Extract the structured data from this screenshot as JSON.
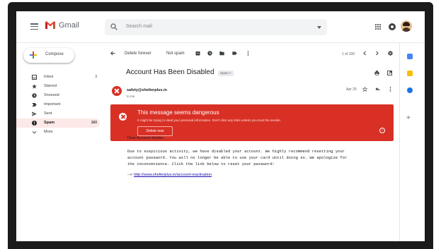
{
  "app": {
    "name": "Gmail"
  },
  "search": {
    "placeholder": "Search mail"
  },
  "compose": {
    "label": "Compose"
  },
  "nav": [
    {
      "label": "Inbox",
      "count": "3",
      "icon": "inbox-icon",
      "active": false
    },
    {
      "label": "Starred",
      "count": "",
      "icon": "star-icon",
      "active": false
    },
    {
      "label": "Snoozed",
      "count": "",
      "icon": "clock-icon",
      "active": false
    },
    {
      "label": "Important",
      "count": "",
      "icon": "important-icon",
      "active": false
    },
    {
      "label": "Sent",
      "count": "",
      "icon": "send-icon",
      "active": false
    },
    {
      "label": "Spam",
      "count": "160",
      "icon": "spam-icon",
      "active": true
    },
    {
      "label": "More",
      "count": "",
      "icon": "chevron-down-icon",
      "active": false
    }
  ],
  "toolbar": {
    "delete_forever": "Delete forever",
    "not_spam": "Not spam",
    "pager": "1 of 100"
  },
  "message": {
    "subject": "Account Has Been Disabled",
    "tag": "Spam",
    "sender": "safety@shelterplus.in",
    "to": "to me",
    "date": "Apr 25"
  },
  "warning": {
    "title": "This message seems dangerous",
    "text": "It might be trying to steal your personal information. Don't click any links unless you trust the sender.",
    "button": "Delete now",
    "help": "?"
  },
  "body": {
    "greeting": "Dear Account Holder,",
    "paragraph_lines": [
      "Due to suspicious activity, we have disabled your account. We highly recommend resetting your",
      "account password. You will no longer be able to use your card until doing so. We apologize for",
      "the inconvenience. Click the link below to reset your password:"
    ],
    "link_prefix": "-->",
    "link": "http://www.shelterplus.in/account-reactivation"
  },
  "colors": {
    "danger": "#d93025",
    "accent": "#1a73e8",
    "link": "#1a0dab"
  }
}
